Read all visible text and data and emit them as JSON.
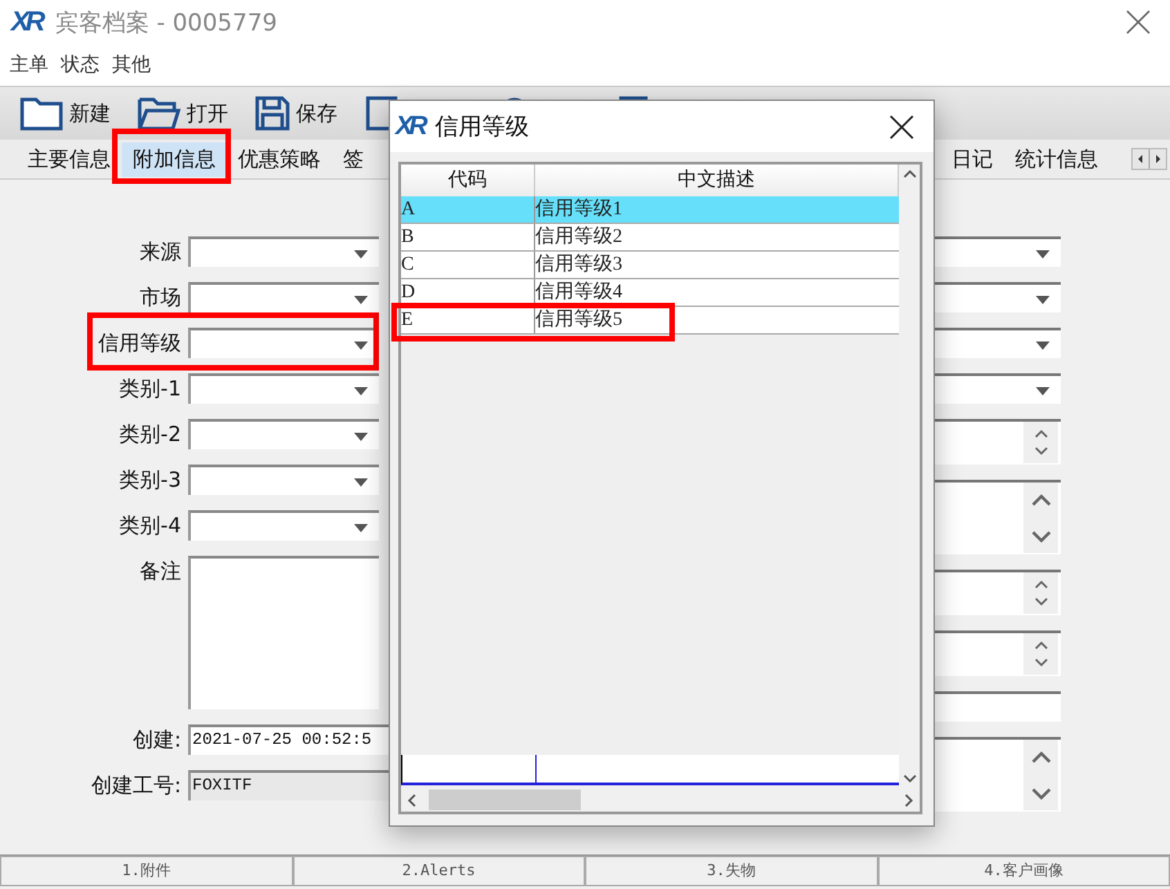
{
  "window": {
    "logo": "XR",
    "title": "宾客档案 - 0005779"
  },
  "menu": [
    "主单",
    "状态",
    "其他"
  ],
  "toolbar": [
    {
      "label": "新建",
      "kind": "folder"
    },
    {
      "label": "打开",
      "kind": "folder-open"
    },
    {
      "label": "保存",
      "kind": "save"
    },
    {
      "kind": "table"
    },
    {
      "kind": "globe"
    },
    {
      "kind": "document"
    }
  ],
  "tabs": [
    {
      "label": "主要信息",
      "selected": false,
      "highlighted": false
    },
    {
      "label": "附加信息",
      "selected": true,
      "highlighted": true
    },
    {
      "label": "优惠策略",
      "selected": false,
      "highlighted": false
    },
    {
      "label": "签",
      "selected": false,
      "highlighted": false
    },
    {
      "label": "日记",
      "selected": false,
      "highlighted": false
    },
    {
      "label": "统计信息",
      "selected": false,
      "highlighted": false
    }
  ],
  "form": {
    "left": [
      {
        "label": "来源",
        "kind": "dropdown",
        "highlighted": false
      },
      {
        "label": "市场",
        "kind": "dropdown",
        "highlighted": false
      },
      {
        "label": "信用等级",
        "kind": "dropdown",
        "highlighted": true
      },
      {
        "label": "类别-1",
        "kind": "dropdown",
        "highlighted": false
      },
      {
        "label": "类别-2",
        "kind": "dropdown",
        "highlighted": false
      },
      {
        "label": "类别-3",
        "kind": "dropdown",
        "highlighted": false
      },
      {
        "label": "类别-4",
        "kind": "dropdown",
        "highlighted": false
      },
      {
        "label": "备注",
        "kind": "memo",
        "highlighted": false
      },
      {
        "label": "创建:",
        "kind": "text",
        "value": "2021-07-25 00:52:5",
        "highlighted": false
      },
      {
        "label": "创建工号:",
        "kind": "readonly",
        "value": "FOXITF",
        "highlighted": false
      }
    ],
    "right": [
      {
        "kind": "dropdown"
      },
      {
        "kind": "dropdown"
      },
      {
        "kind": "dropdown"
      },
      {
        "kind": "dropdown"
      },
      {
        "kind": "spinner"
      },
      {
        "kind": "memo"
      },
      {
        "kind": "spinner"
      },
      {
        "kind": "spinner"
      },
      {
        "kind": "text"
      },
      {
        "kind": "memo"
      }
    ]
  },
  "dialog": {
    "logo": "XR",
    "title": "信用等级",
    "columns": [
      "代码",
      "中文描述"
    ],
    "rows": [
      {
        "code": "A",
        "description": "信用等级1",
        "selected": true,
        "highlighted": false
      },
      {
        "code": "B",
        "description": "信用等级2",
        "selected": false,
        "highlighted": false
      },
      {
        "code": "C",
        "description": "信用等级3",
        "selected": false,
        "highlighted": false
      },
      {
        "code": "D",
        "description": "信用等级4",
        "selected": false,
        "highlighted": false
      },
      {
        "code": "E",
        "description": "信用等级5",
        "selected": false,
        "highlighted": true
      }
    ]
  },
  "bottom_tabs": [
    "1.附件",
    "2.Alerts",
    "3.失物",
    "4.客户画像"
  ]
}
